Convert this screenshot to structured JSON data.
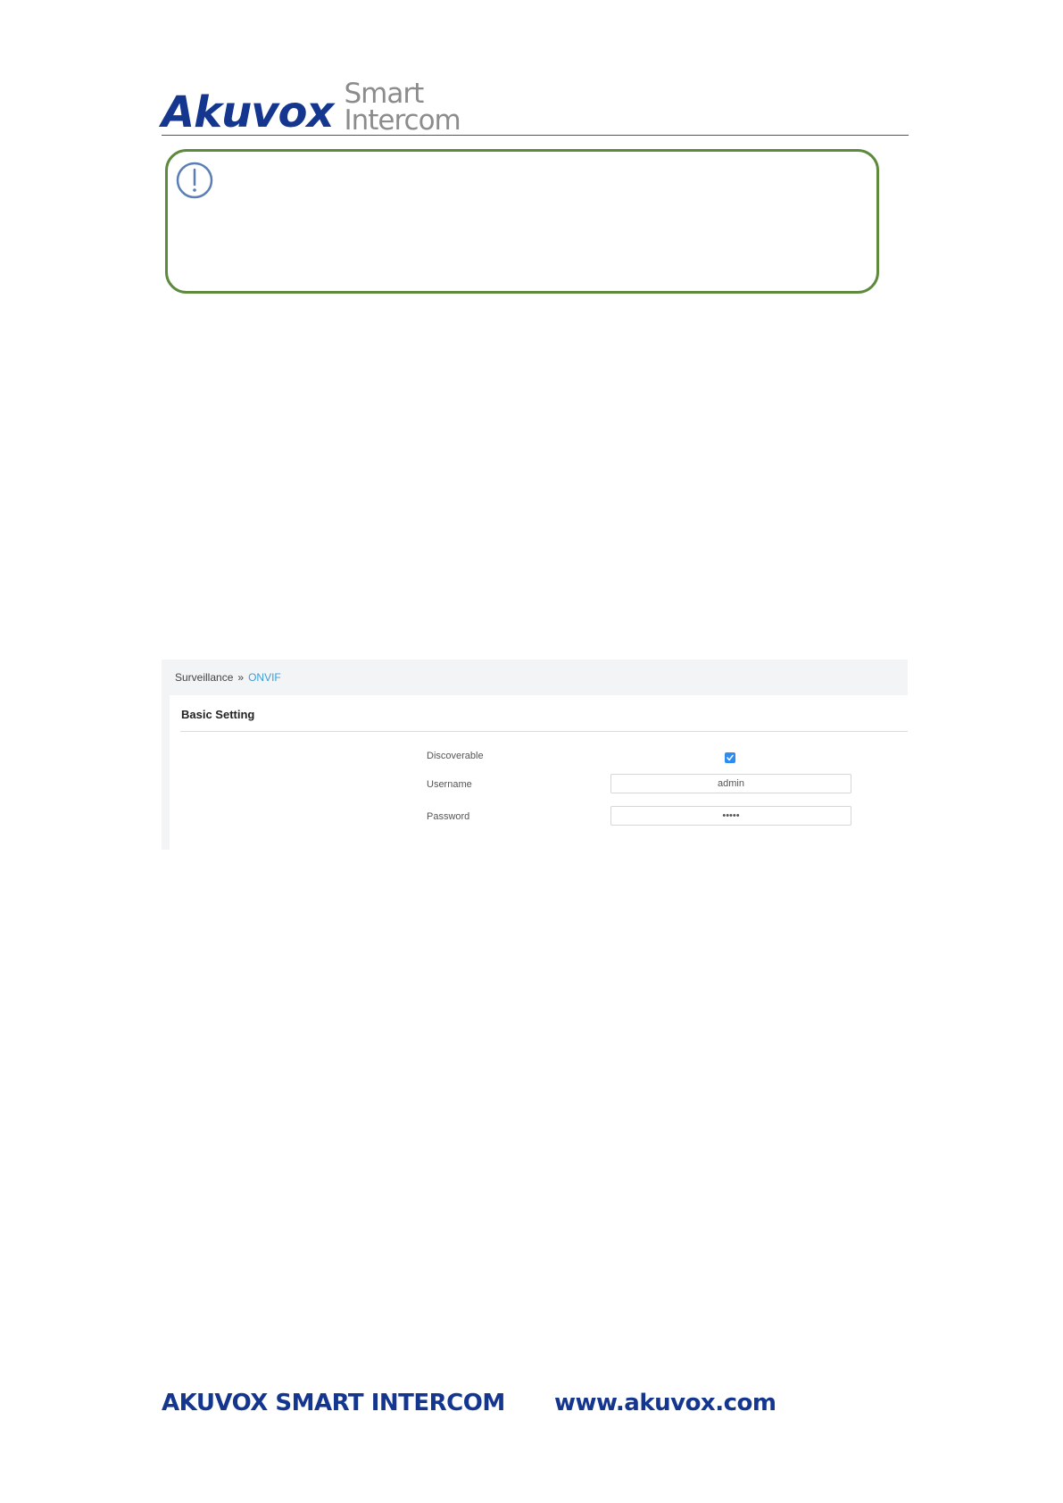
{
  "header": {
    "logo_main": "Akuvox",
    "logo_sub_line1": "Smart",
    "logo_sub_line2": "Intercom"
  },
  "note": {
    "icon": "exclamation-circle-icon"
  },
  "screenshot": {
    "breadcrumb": {
      "parent": "Surveillance",
      "separator": "»",
      "current": "ONVIF"
    },
    "panel_title": "Basic Setting",
    "fields": {
      "discoverable_label": "Discoverable",
      "discoverable_checked": true,
      "username_label": "Username",
      "username_value": "admin",
      "password_label": "Password",
      "password_value": "•••••"
    },
    "colors": {
      "accent": "#2d8cf0",
      "breadcrumb_current": "#3a9ed6"
    }
  },
  "footer": {
    "company": "AKUVOX SMART INTERCOM",
    "website": "www.akuvox.com"
  },
  "colors": {
    "brand": "#14368f",
    "note_border": "#5d8a3c"
  }
}
